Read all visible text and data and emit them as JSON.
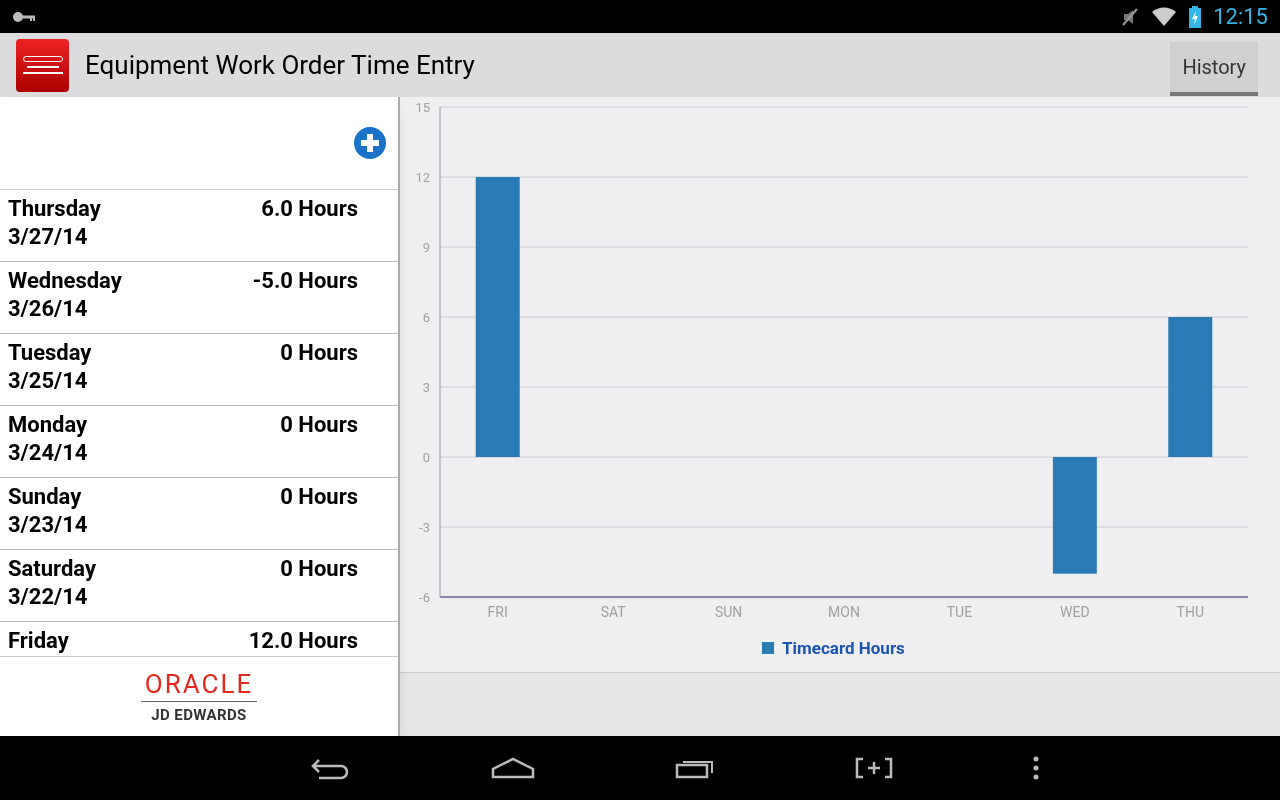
{
  "status_bar": {
    "time": "12:15"
  },
  "action_bar": {
    "title": "Equipment Work Order Time Entry",
    "history_button": "History"
  },
  "entries": [
    {
      "day": "Thursday",
      "date": "3/27/14",
      "hours": "6.0 Hours"
    },
    {
      "day": "Wednesday",
      "date": "3/26/14",
      "hours": "-5.0 Hours"
    },
    {
      "day": "Tuesday",
      "date": "3/25/14",
      "hours": "0 Hours"
    },
    {
      "day": "Monday",
      "date": "3/24/14",
      "hours": "0 Hours"
    },
    {
      "day": "Sunday",
      "date": "3/23/14",
      "hours": "0 Hours"
    },
    {
      "day": "Saturday",
      "date": "3/22/14",
      "hours": "0 Hours"
    },
    {
      "day": "Friday",
      "hours": "12.0 Hours"
    }
  ],
  "footer_logo": {
    "brand": "ORACLE",
    "product": "JD EDWARDS"
  },
  "chart": {
    "chart_data": {
      "type": "bar",
      "categories": [
        "FRI",
        "SAT",
        "SUN",
        "MON",
        "TUE",
        "WED",
        "THU"
      ],
      "series": [
        {
          "name": "Timecard Hours",
          "color": "#2a7ab5",
          "values": [
            12,
            0,
            0,
            0,
            0,
            -5,
            6
          ]
        }
      ],
      "ylim": [
        -6,
        15
      ],
      "grid": true,
      "yticks": [
        -6,
        -3,
        0,
        3,
        6,
        9,
        12,
        15
      ]
    }
  }
}
